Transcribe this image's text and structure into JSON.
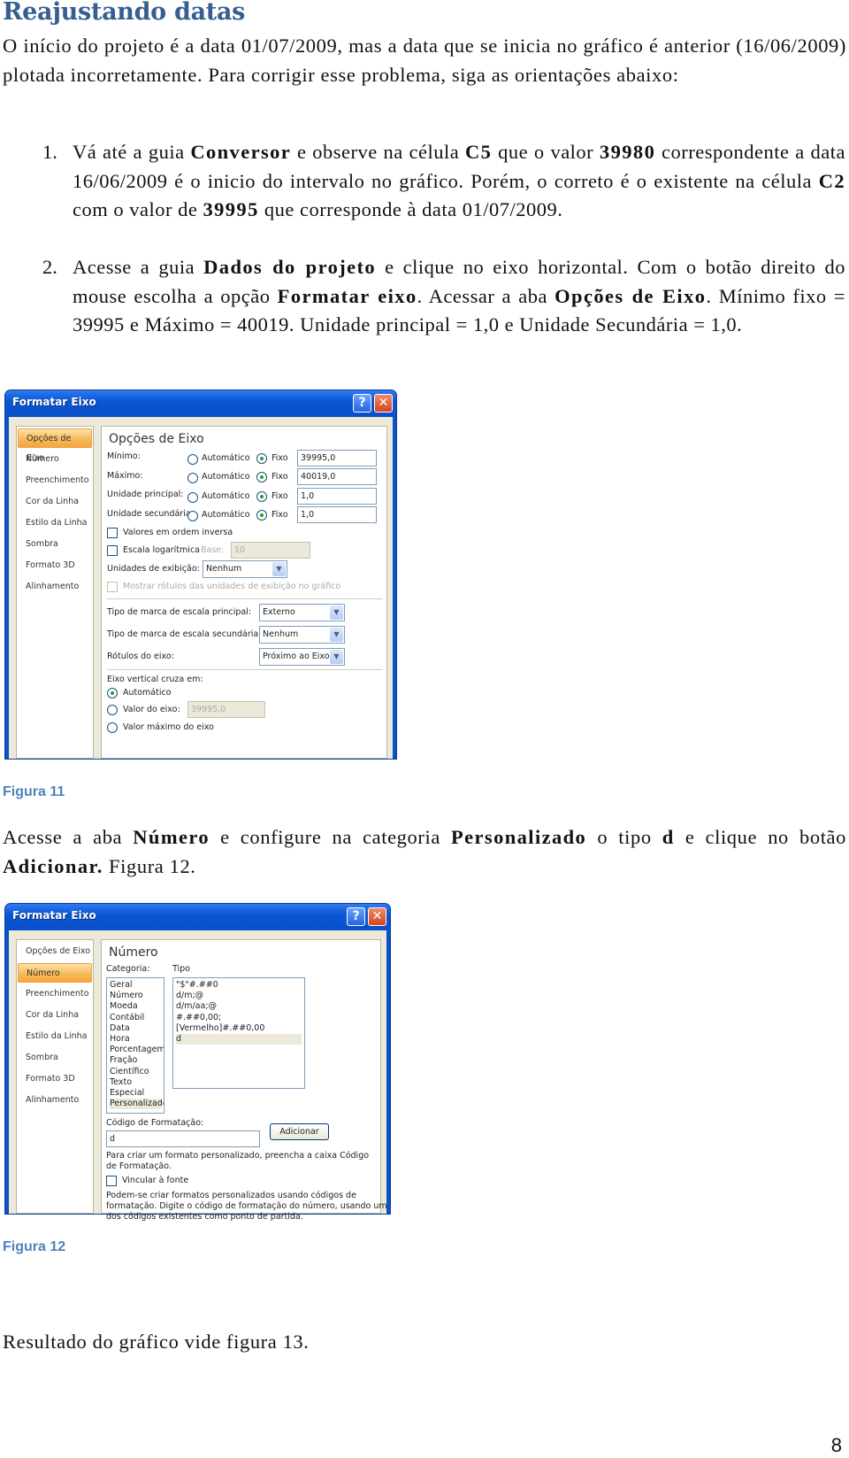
{
  "heading": "Reajustando datas",
  "intro": "O início do projeto é a data 01/07/2009, mas a data que se inicia no gráfico é anterior (16/06/2009) plotada incorretamente. Para corrigir esse problema, siga as orientações abaixo:",
  "steps": [
    {
      "number": "1.",
      "parts": [
        "Vá até a guia ",
        "Conversor",
        " e observe na célula ",
        "C5",
        " que o valor ",
        "39980",
        " correspondente a data 16/06/2009 é o inicio do intervalo no gráfico. Porém, o correto é o existente na célula ",
        "C2",
        " com o valor de ",
        "39995",
        " que corresponde à data 01/07/2009."
      ]
    },
    {
      "number": "2.",
      "parts": [
        "Acesse a guia ",
        "Dados do projeto",
        " e clique no eixo horizontal. Com o botão direito do mouse escolha a opção ",
        "Formatar eixo",
        ". Acessar a aba ",
        "Opções de Eixo",
        ". Mínimo fixo = 39995 e Máximo = 40019. Unidade principal = 1,0 e Unidade Secundária = 1,0."
      ]
    }
  ],
  "figure11": {
    "dialog_title": "Formatar Eixo",
    "help_button": "?",
    "close_button": "✕",
    "nav_items": [
      "Opções de Eixo",
      "Número",
      "Preenchimento",
      "Cor da Linha",
      "Estilo da Linha",
      "Sombra",
      "Formato 3D",
      "Alinhamento"
    ],
    "selected_nav": "Opções de Eixo",
    "pane_title": "Opções de Eixo",
    "rows": [
      {
        "label": "Mínimo:",
        "auto": "Automático",
        "fixed": "Fixo",
        "value": "39995,0"
      },
      {
        "label": "Máximo:",
        "auto": "Automático",
        "fixed": "Fixo",
        "value": "40019,0"
      },
      {
        "label": "Unidade principal:",
        "auto": "Automático",
        "fixed": "Fixo",
        "value": "1,0"
      },
      {
        "label": "Unidade secundária:",
        "auto": "Automático",
        "fixed": "Fixo",
        "value": "1,0"
      }
    ],
    "reverse_order": "Valores em ordem inversa",
    "log_scale": "Escala logarítmica",
    "base_label": "Base:",
    "base_value": "10",
    "display_units_label": "Unidades de exibição:",
    "display_units_value": "Nenhum",
    "show_units_label": "Mostrar rótulos das unidades de exibição no gráfico",
    "major_tick_label": "Tipo de marca de escala principal:",
    "major_tick_value": "Externo",
    "minor_tick_label": "Tipo de marca de escala secundária:",
    "minor_tick_value": "Nenhum",
    "axis_labels_label": "Rótulos do eixo:",
    "axis_labels_value": "Próximo ao Eixo",
    "cross_label": "Eixo vertical cruza em:",
    "cross_auto": "Automático",
    "cross_value_label": "Valor do eixo:",
    "cross_value": "39995,0",
    "cross_max": "Valor máximo do eixo",
    "dropdown_arrow": "▼"
  },
  "caption11": "Figura 11",
  "para2": {
    "parts": [
      "Acesse a aba ",
      "Número",
      " e configure na categoria ",
      "Personalizado",
      " o tipo ",
      "d",
      " e clique no botão ",
      "Adicionar.",
      " Figura 12."
    ]
  },
  "figure12": {
    "dialog_title": "Formatar Eixo",
    "help_button": "?",
    "close_button": "✕",
    "nav_items": [
      "Opções de Eixo",
      "Número",
      "Preenchimento",
      "Cor da Linha",
      "Estilo da Linha",
      "Sombra",
      "Formato 3D",
      "Alinhamento"
    ],
    "selected_nav": "Número",
    "pane_title": "Número",
    "category_label": "Categoria:",
    "type_label": "Tipo",
    "categories": [
      "Geral",
      "Número",
      "Moeda",
      "Contábil",
      "Data",
      "Hora",
      "Porcentagem",
      "Fração",
      "Científico",
      "Texto",
      "Especial",
      "Personalizado"
    ],
    "types": [
      "\"$\"#.##0",
      "d/m;@",
      "d/m/aa;@",
      "#.##0,00;[Vermelho]#.##0,00",
      "d"
    ],
    "selected_type": "d",
    "format_code_label": "Código de Formatação:",
    "format_code_value": "d",
    "add_button": "Adicionar",
    "hint1": "Para criar um formato personalizado, preencha a caixa Código de Formatação.",
    "link_source": "Vincular à fonte",
    "hint2": "Podem-se criar formatos personalizados usando códigos de formatação. Digite o código de formatação do número, usando um dos códigos existentes como ponto de partida."
  },
  "caption12": "Figura 12",
  "result": "Resultado do gráfico vide figura 13.",
  "page_number": "8"
}
